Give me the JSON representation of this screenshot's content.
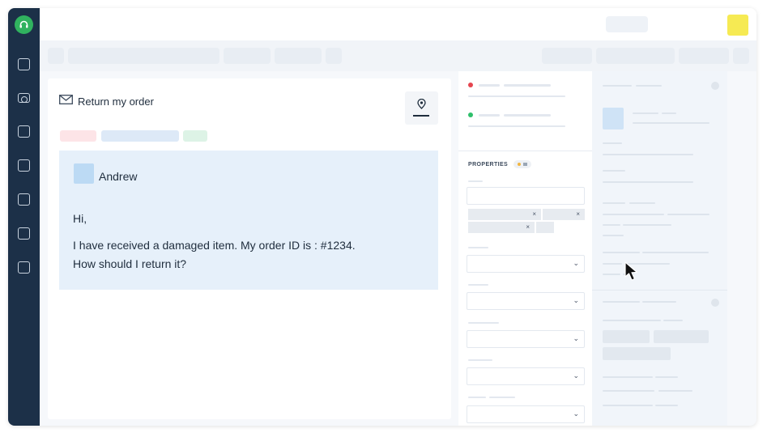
{
  "colors": {
    "sidebar": "#1c3048",
    "logo": "#30b25f",
    "top_avatar": "#f6ea53",
    "message_bg": "#e6f0fa",
    "status_red": "#e5454f",
    "status_green": "#2fbf6b"
  },
  "sidebar": {
    "logo_icon": "headset-icon",
    "items": [
      {
        "icon": "square-icon"
      },
      {
        "icon": "inbox-icon"
      },
      {
        "icon": "square-icon"
      },
      {
        "icon": "square-icon"
      },
      {
        "icon": "square-icon"
      },
      {
        "icon": "square-icon"
      },
      {
        "icon": "square-icon"
      }
    ]
  },
  "ticket": {
    "title": "Return my order",
    "title_icon": "envelope-icon",
    "pin_icon": "location-pin-icon"
  },
  "message": {
    "sender": "Andrew",
    "greeting": "Hi,",
    "line1": "I have received a damaged item. My order ID is : #1234.",
    "line2": "How should I return it?"
  },
  "properties": {
    "label": "PROPERTIES",
    "chip_close": "×",
    "dropdown_chevron": "⌄"
  }
}
